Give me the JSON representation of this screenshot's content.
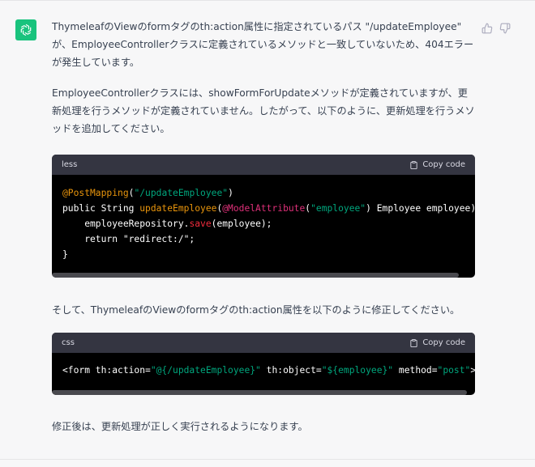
{
  "message": {
    "paragraph1": "ThymeleafのViewのformタグのth:action属性に指定されているパス \"/updateEmployee\" が、EmployeeControllerクラスに定義されているメソッドと一致していないため、404エラーが発生しています。",
    "paragraph2": "EmployeeControllerクラスには、showFormForUpdateメソッドが定義されていますが、更新処理を行うメソッドが定義されていません。したがって、以下のように、更新処理を行うメソッドを追加してください。",
    "paragraph3": "そして、ThymeleafのViewのformタグのth:action属性を以下のように修正してください。",
    "paragraph4": "修正後は、更新処理が正しく実行されるようになります。"
  },
  "code_blocks": [
    {
      "language": "less",
      "copy_label": "Copy code",
      "lines": [
        "@PostMapping(\"/updateEmployee\")",
        "public String updateEmployee(@ModelAttribute(\"employee\") Employee employee)",
        "    employeeRepository.save(employee);",
        "    return \"redirect:/\";",
        "}"
      ]
    },
    {
      "language": "css",
      "copy_label": "Copy code",
      "lines": [
        "<form th:action=\"@{/updateEmployee}\" th:object=\"${employee}\" method=\"post\">"
      ]
    }
  ],
  "icons": {
    "avatar": "openai-logo-icon",
    "thumbs_up": "thumbs-up-icon",
    "thumbs_down": "thumbs-down-icon",
    "copy": "clipboard-icon"
  },
  "colors": {
    "avatar_bg": "#19c37d",
    "code_bg": "#000000",
    "code_header_bg": "#343541",
    "string": "#00a67d",
    "annotation": "#e9950c",
    "function": "#f22c3d"
  }
}
